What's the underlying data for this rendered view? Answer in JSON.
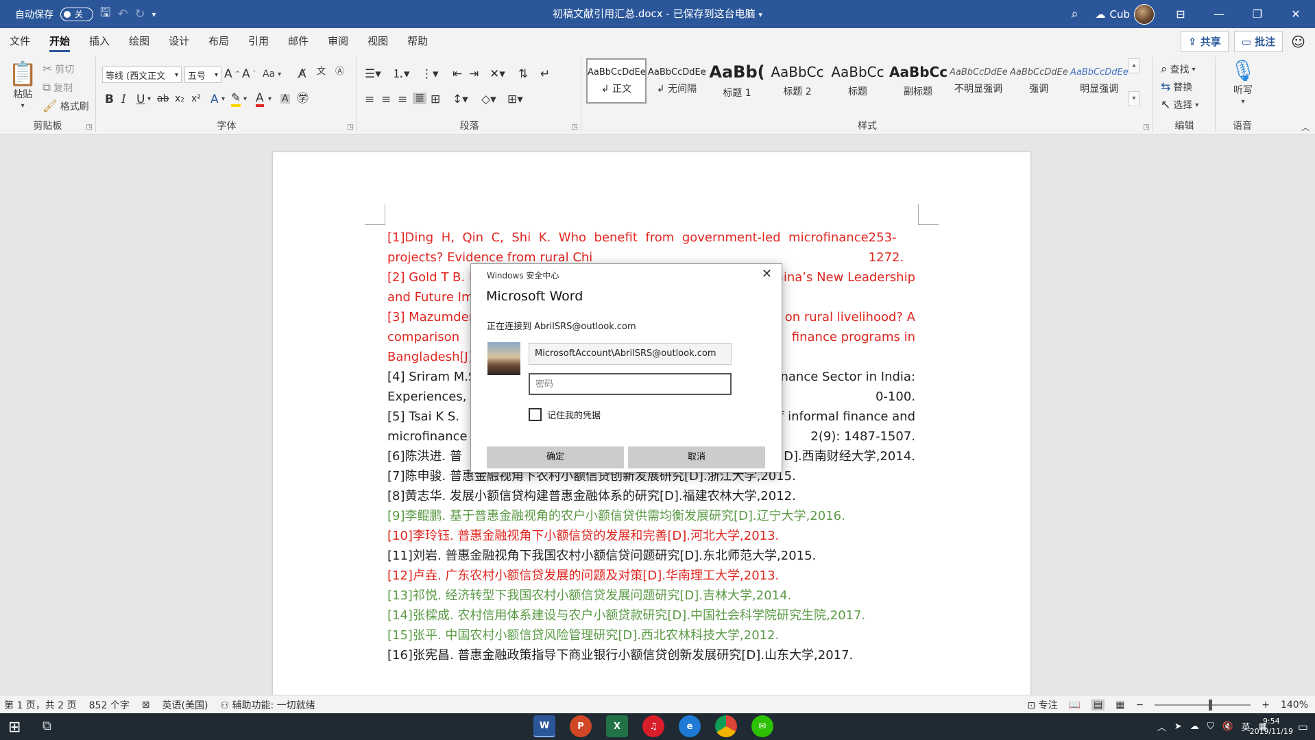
{
  "titlebar": {
    "autosave_label": "自动保存",
    "autosave_state": "关",
    "doc_title": "初稿文献引用汇总.docx  -  已保存到这台电脑",
    "user_name": "Cub",
    "save_icon": "save-icon",
    "accent": "#2b579a"
  },
  "tabs": {
    "items": [
      "文件",
      "开始",
      "插入",
      "绘图",
      "设计",
      "布局",
      "引用",
      "邮件",
      "审阅",
      "视图",
      "帮助"
    ],
    "active": "开始",
    "share": "共享",
    "comment": "批注"
  },
  "ribbon": {
    "clipboard": {
      "label": "剪贴板",
      "paste": "粘贴",
      "cut": "剪切",
      "copy": "复制",
      "format_painter": "格式刷"
    },
    "font": {
      "label": "字体",
      "font_name": "等线 (西文正文",
      "font_size": "五号",
      "aa": "Aa"
    },
    "paragraph": {
      "label": "段落"
    },
    "styles": {
      "label": "样式",
      "items": [
        {
          "sample": "AaBbCcDdEe",
          "name": "↲ 正文"
        },
        {
          "sample": "AaBbCcDdEe",
          "name": "↲ 无间隔"
        },
        {
          "sample": "AaBb(",
          "name": "标题 1"
        },
        {
          "sample": "AaBbCc",
          "name": "标题 2"
        },
        {
          "sample": "AaBbCc",
          "name": "标题"
        },
        {
          "sample": "AaBbCc",
          "name": "副标题"
        },
        {
          "sample": "AaBbCcDdEe",
          "name": "不明显强调"
        },
        {
          "sample": "AaBbCcDdEe",
          "name": "强调"
        },
        {
          "sample": "AaBbCcDdEe",
          "name": "明显强调"
        }
      ]
    },
    "editing": {
      "label": "编辑",
      "find": "查找",
      "replace": "替换",
      "select": "选择"
    },
    "voice": {
      "label": "语音",
      "dictate": "听写"
    }
  },
  "document": {
    "colors": {
      "red": "#e0261f",
      "green": "#5b9a46",
      "black": "#222222"
    },
    "refs": [
      {
        "color": "red",
        "text": "[1]Ding H, Qin C, Shi K. Who benefit from government-led microfinance projects? Evidence from rural Chi"
      },
      {
        "color": "red",
        "text": "253-1272."
      },
      {
        "color": "red",
        "text": "[2] Gold T B. M"
      },
      {
        "color": "red",
        "text": "China’s New Leadership"
      },
      {
        "color": "red",
        "text": "and Future Imp"
      },
      {
        "color": "red",
        "text": "[3] Mazumder"
      },
      {
        "color": "red",
        "text": "e on rural livelihood? A"
      },
      {
        "color": "red",
        "text": "comparison"
      },
      {
        "color": "red",
        "text": "finance programs in"
      },
      {
        "color": "red",
        "text": "Bangladesh[J]."
      },
      {
        "color": "black",
        "text": "[4] Sriram M.S."
      },
      {
        "color": "black",
        "text": "rofinance Sector in India:"
      },
      {
        "color": "black",
        "text": "Experiences, C"
      },
      {
        "color": "black",
        "text": "0-100."
      },
      {
        "color": "black",
        "text": "[5] Tsai K S."
      },
      {
        "color": "black",
        "text": "f informal finance and"
      },
      {
        "color": "black",
        "text": "microfinance i"
      },
      {
        "color": "black",
        "text": "2(9): 1487-1507."
      },
      {
        "color": "black",
        "text": "[6]陈洪进. 普"
      },
      {
        "color": "black",
        "text": "D].西南财经大学,2014."
      },
      {
        "color": "black",
        "text": "[7]陈申骏. 普惠金融视角下农村小额信贷创新发展研究[D].浙江大学,2015."
      },
      {
        "color": "black",
        "text": "[8]黄志华. 发展小额信贷构建普惠金融体系的研究[D].福建农林大学,2012."
      },
      {
        "color": "green",
        "text": "[9]李鲲鹏. 基于普惠金融视角的农户小额信贷供需均衡发展研究[D].辽宁大学,2016."
      },
      {
        "color": "red",
        "text": "[10]李玲钰. 普惠金融视角下小额信贷的发展和完善[D].河北大学,2013."
      },
      {
        "color": "black",
        "text": "[11]刘岩. 普惠金融视角下我国农村小额信贷问题研究[D].东北师范大学,2015."
      },
      {
        "color": "red",
        "text": "[12]卢垚. 广东农村小额信贷发展的问题及对策[D].华南理工大学,2013."
      },
      {
        "color": "green",
        "text": "[13]祁悦. 经济转型下我国农村小额信贷发展问题研究[D].吉林大学,2014."
      },
      {
        "color": "green",
        "text": "[14]张樑成. 农村信用体系建设与农户小额贷款研究[D].中国社会科学院研究生院,2017."
      },
      {
        "color": "green",
        "text": "[15]张平. 中国农村小额信贷风险管理研究[D].西北农林科技大学,2012."
      },
      {
        "color": "black",
        "text": "[16]张宪昌. 普惠金融政策指导下商业银行小额信贷创新发展研究[D].山东大学,2017."
      }
    ]
  },
  "dialog": {
    "caption": "Windows 安全中心",
    "app": "Microsoft Word",
    "connecting": "正在连接到  AbrilSRS@outlook.com",
    "username": "MicrosoftAccount\\AbrilSRS@outlook.com",
    "password_placeholder": "密码",
    "remember": "记住我的凭据",
    "ok": "确定",
    "cancel": "取消"
  },
  "statusbar": {
    "page": "第 1 页，共 2 页",
    "words": "852 个字",
    "language": "英语(美国)",
    "accessibility": "辅助功能: 一切就绪",
    "focus": "专注",
    "zoom": "140%",
    "zoom_fraction": 0.58
  },
  "taskbar": {
    "time": "9:54",
    "date": "2019/11/19",
    "ime": "英"
  }
}
